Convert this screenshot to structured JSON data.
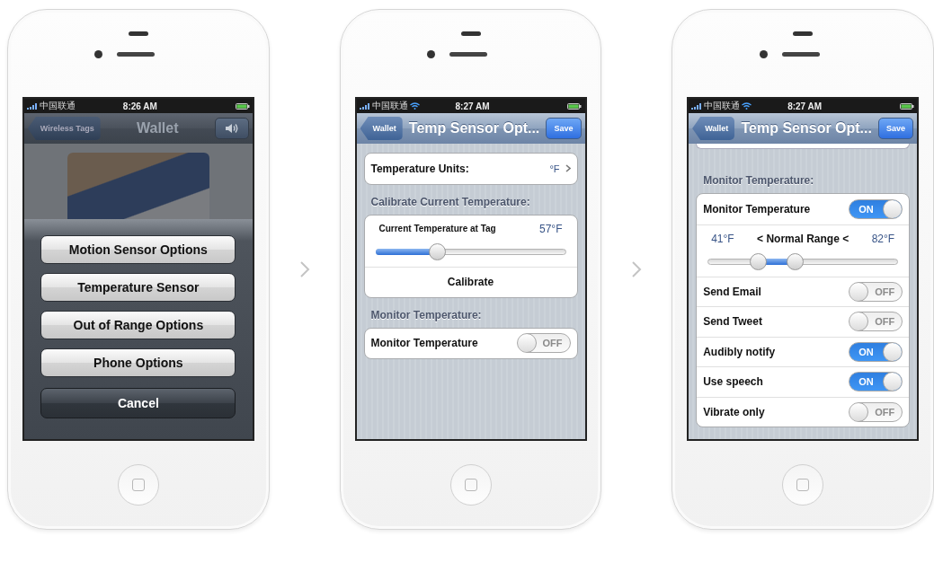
{
  "phones": [
    {
      "kind": "action_sheet",
      "status": {
        "carrier": "中国联通",
        "time": "8:26 AM",
        "wifi": false
      },
      "nav": {
        "back": "Wireless Tags",
        "title": "Wallet",
        "right": {
          "kind": "speaker"
        }
      },
      "sheet": {
        "buttons": [
          "Motion Sensor Options",
          "Temperature Sensor",
          "Out of Range Options",
          "Phone Options"
        ],
        "cancel": "Cancel"
      }
    },
    {
      "kind": "settings",
      "status": {
        "carrier": "中国联通",
        "time": "8:27 AM",
        "wifi": true
      },
      "nav": {
        "back": "Wallet",
        "title": "Temp Sensor Opt...",
        "right": {
          "kind": "text",
          "label": "Save"
        }
      },
      "clipped_group_above": false,
      "groups": [
        {
          "rows": [
            {
              "kind": "disclosure",
              "label": "Temperature Units:",
              "value": "°F"
            }
          ]
        },
        {
          "header": "Calibrate Current Temperature:",
          "rows": [
            {
              "kind": "slider",
              "label": "Current Temperature at Tag",
              "value": "57°F",
              "level": 0.33
            },
            {
              "kind": "button",
              "label": "Calibrate"
            }
          ]
        },
        {
          "header": "Monitor Temperature:",
          "rows": [
            {
              "kind": "switch",
              "label": "Monitor Temperature",
              "on": false,
              "switch_text": "OFF"
            }
          ]
        }
      ]
    },
    {
      "kind": "settings",
      "status": {
        "carrier": "中国联通",
        "time": "8:27 AM",
        "wifi": true
      },
      "nav": {
        "back": "Wallet",
        "title": "Temp Sensor Opt...",
        "right": {
          "kind": "text",
          "label": "Save"
        }
      },
      "clipped_group_above": true,
      "groups": [
        {
          "header": "Monitor Temperature:",
          "rows": [
            {
              "kind": "switch",
              "label": "Monitor Temperature",
              "on": true,
              "switch_text": "ON"
            },
            {
              "kind": "range",
              "low": "41°F",
              "label": "< Normal Range <",
              "high": "82°F",
              "thumbs": [
                {
                  "level": 0.27
                },
                {
                  "level": 0.46
                }
              ]
            },
            {
              "kind": "switch",
              "label": "Send Email",
              "on": false,
              "switch_text": "OFF"
            },
            {
              "kind": "switch",
              "label": "Send Tweet",
              "on": false,
              "switch_text": "OFF"
            },
            {
              "kind": "switch",
              "label": "Audibly notify",
              "on": true,
              "switch_text": "ON"
            },
            {
              "kind": "switch",
              "label": "Use speech",
              "on": true,
              "switch_text": "ON"
            },
            {
              "kind": "switch",
              "label": "Vibrate only",
              "on": false,
              "switch_text": "OFF"
            }
          ]
        }
      ]
    }
  ]
}
